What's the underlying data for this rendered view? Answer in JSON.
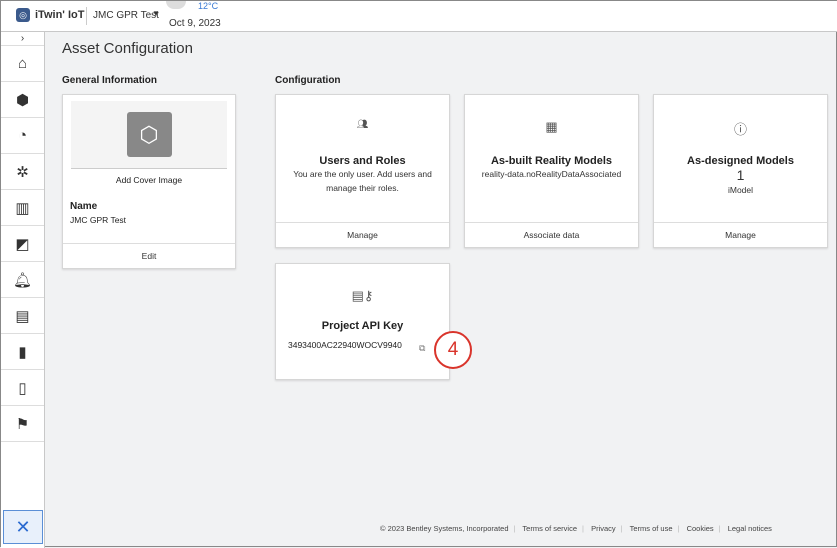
{
  "header": {
    "logo_icon": "itwin-logo-icon",
    "brand": "iTwin' IoT",
    "project": "JMC GPR Test",
    "weather_temp": "12°C",
    "date": "Oct 9, 2023"
  },
  "sidebar": {
    "items": [
      "home-icon",
      "cube-icon",
      "gauge-icon",
      "network-icon",
      "bar-chart-icon",
      "map-icon",
      "alert-settings-icon",
      "clipboard-icon",
      "document-icon",
      "document-2-icon",
      "flag-icon"
    ],
    "active": "tools-icon"
  },
  "page": {
    "title": "Asset Configuration",
    "general_heading": "General Information",
    "config_heading": "Configuration"
  },
  "general": {
    "add_cover": "Add Cover Image",
    "name_label": "Name",
    "name_value": "JMC GPR Test",
    "edit": "Edit"
  },
  "cards": [
    {
      "title": "Users and Roles",
      "desc": "You are the only user. Add users and manage their roles.",
      "action": "Manage"
    },
    {
      "title": "As-built Reality Models",
      "desc": "reality-data.noRealityDataAssociated",
      "action": "Associate data"
    },
    {
      "title": "As-designed Models",
      "count": "1",
      "desc": "iModel",
      "action": "Manage"
    }
  ],
  "api": {
    "title": "Project API Key",
    "key": "3493400AC22940WOCV9940"
  },
  "annotation": "4",
  "footer": [
    "© 2023 Bentley Systems, Incorporated",
    "Terms of service",
    "Privacy",
    "Terms of use",
    "Cookies",
    "Legal notices"
  ],
  "colors": {
    "accent": "#2a6ad0",
    "annotation": "#d9342b"
  }
}
